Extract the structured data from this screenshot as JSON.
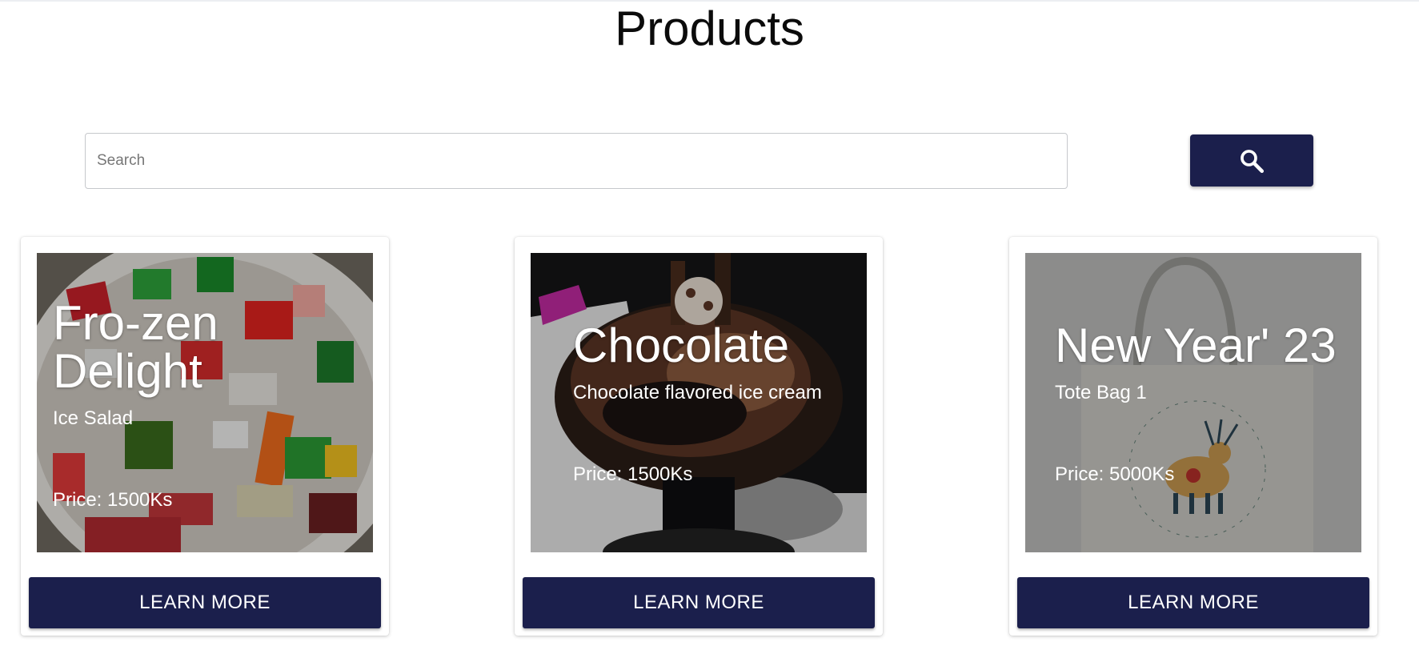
{
  "page": {
    "title": "Products"
  },
  "search": {
    "placeholder": "Search",
    "value": ""
  },
  "colors": {
    "primary": "#1b1f4c",
    "background": "#ffffff"
  },
  "products": [
    {
      "title": "Fro-zen Delight",
      "description": "Ice Salad",
      "price": "Price: 1500Ks",
      "button": "LEARN MORE"
    },
    {
      "title": "Chocolate",
      "description": "Chocolate flavored ice cream",
      "price": "Price: 1500Ks",
      "button": "LEARN MORE"
    },
    {
      "title": "New Year' 23",
      "description": "Tote Bag 1",
      "price": "Price: 5000Ks",
      "button": "LEARN MORE"
    }
  ]
}
